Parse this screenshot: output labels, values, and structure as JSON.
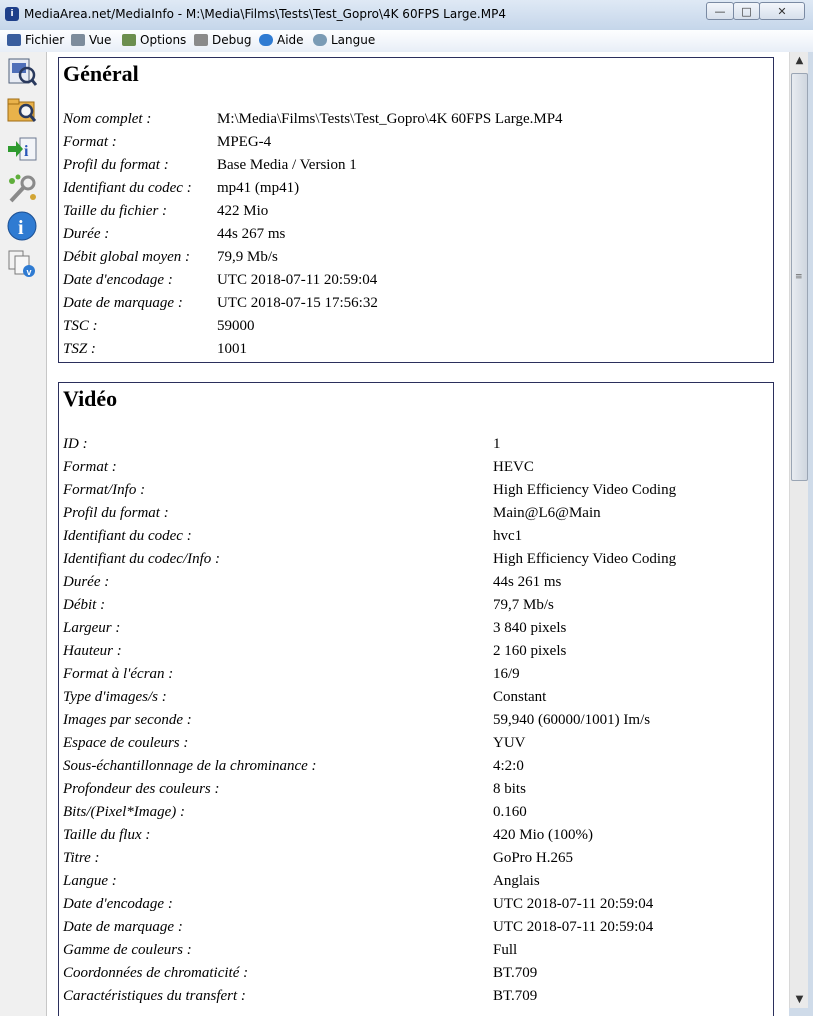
{
  "window": {
    "title": "MediaArea.net/MediaInfo - M:\\Media\\Films\\Tests\\Test_Gopro\\4K 60FPS Large.MP4",
    "buttons": {
      "minimize": "—",
      "maximize": "□",
      "close": "✕"
    }
  },
  "menu": [
    {
      "label": "Fichier",
      "icon": "file-icon",
      "color": "#3a5e9e"
    },
    {
      "label": "Vue",
      "icon": "view-icon",
      "color": "#7d8c9c"
    },
    {
      "label": "Options",
      "icon": "options-icon",
      "color": "#6b8e4e"
    },
    {
      "label": "Debug",
      "icon": "debug-icon",
      "color": "#8a8a8a"
    },
    {
      "label": "Aide",
      "icon": "help-icon",
      "color": "#2f7bd2"
    },
    {
      "label": "Langue",
      "icon": "language-icon",
      "color": "#7a9bb5"
    }
  ],
  "toolbar": [
    {
      "name": "open-file-icon"
    },
    {
      "name": "open-folder-icon"
    },
    {
      "name": "export-icon"
    },
    {
      "name": "preferences-icon"
    },
    {
      "name": "info-icon"
    },
    {
      "name": "copy-icon"
    }
  ],
  "general": {
    "title": "Général",
    "rows": [
      {
        "key": "Nom complet :",
        "value": "M:\\Media\\Films\\Tests\\Test_Gopro\\4K 60FPS Large.MP4"
      },
      {
        "key": "Format :",
        "value": "MPEG-4"
      },
      {
        "key": "Profil du format :",
        "value": "Base Media / Version 1"
      },
      {
        "key": "Identifiant du codec :",
        "value": "mp41 (mp41)"
      },
      {
        "key": "Taille du fichier :",
        "value": "422 Mio"
      },
      {
        "key": "Durée :",
        "value": "44s 267 ms"
      },
      {
        "key": "Débit global moyen :",
        "value": "79,9 Mb/s"
      },
      {
        "key": "Date d'encodage :",
        "value": "UTC 2018-07-11 20:59:04"
      },
      {
        "key": "Date de marquage :",
        "value": "UTC 2018-07-15 17:56:32"
      },
      {
        "key": "TSC :",
        "value": "59000"
      },
      {
        "key": "TSZ :",
        "value": "1001"
      }
    ]
  },
  "video": {
    "title": "Vidéo",
    "rows": [
      {
        "key": "ID :",
        "value": "1"
      },
      {
        "key": "Format :",
        "value": "HEVC"
      },
      {
        "key": "Format/Info :",
        "value": "High Efficiency Video Coding"
      },
      {
        "key": "Profil du format :",
        "value": "Main@L6@Main"
      },
      {
        "key": "Identifiant du codec :",
        "value": "hvc1"
      },
      {
        "key": "Identifiant du codec/Info :",
        "value": "High Efficiency Video Coding"
      },
      {
        "key": "Durée :",
        "value": "44s 261 ms"
      },
      {
        "key": "Débit :",
        "value": "79,7 Mb/s"
      },
      {
        "key": "Largeur :",
        "value": "3 840 pixels"
      },
      {
        "key": "Hauteur :",
        "value": "2 160 pixels"
      },
      {
        "key": "Format à l'écran :",
        "value": "16/9"
      },
      {
        "key": "Type d'images/s :",
        "value": "Constant"
      },
      {
        "key": "Images par seconde :",
        "value": "59,940 (60000/1001) Im/s"
      },
      {
        "key": "Espace de couleurs :",
        "value": "YUV"
      },
      {
        "key": "Sous-échantillonnage de la chrominance :",
        "value": "4:2:0"
      },
      {
        "key": "Profondeur des couleurs :",
        "value": "8 bits"
      },
      {
        "key": "Bits/(Pixel*Image) :",
        "value": "0.160"
      },
      {
        "key": "Taille du flux :",
        "value": "420 Mio (100%)"
      },
      {
        "key": "Titre :",
        "value": "GoPro H.265"
      },
      {
        "key": "Langue :",
        "value": "Anglais"
      },
      {
        "key": "Date d'encodage :",
        "value": "UTC 2018-07-11 20:59:04"
      },
      {
        "key": "Date de marquage :",
        "value": "UTC 2018-07-11 20:59:04"
      },
      {
        "key": "Gamme de couleurs :",
        "value": "Full"
      },
      {
        "key": "Coordonnées de chromaticité :",
        "value": "BT.709"
      },
      {
        "key": "Caractéristiques du transfert :",
        "value": "BT.709"
      }
    ]
  }
}
